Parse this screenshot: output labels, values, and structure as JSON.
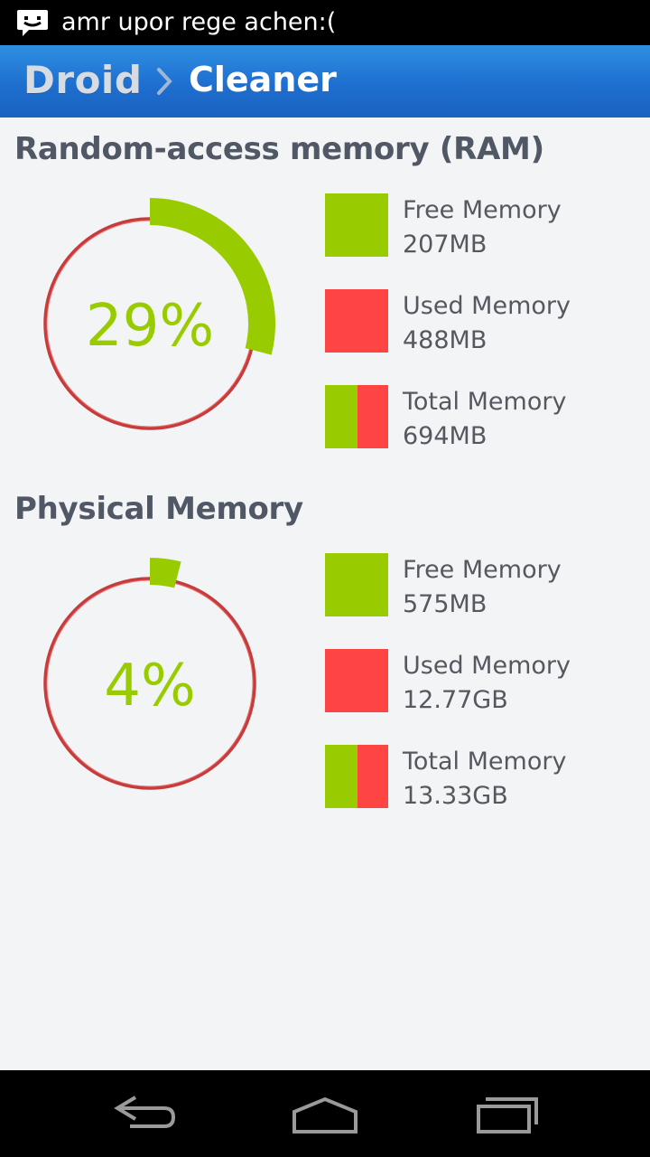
{
  "status_bar": {
    "notification_icon": "chat-bubble-icon",
    "notification_text": "amr upor rege achen:("
  },
  "action_bar": {
    "breadcrumb_root": "Droid",
    "separator_icon": "chevron-right-icon",
    "breadcrumb_current": "Cleaner"
  },
  "colors": {
    "accent_green": "#99cc00",
    "used_red": "#ff4444",
    "ring_red": "#d04545",
    "text_gray": "#55595f"
  },
  "sections": [
    {
      "title": "Random-access memory (RAM)",
      "percent_label": "29%",
      "percent_fraction": 0.29,
      "legend": [
        {
          "label": "Free Memory",
          "value": "207MB",
          "swatch": "free"
        },
        {
          "label": "Used Memory",
          "value": "488MB",
          "swatch": "used"
        },
        {
          "label": "Total Memory",
          "value": "694MB",
          "swatch": "total"
        }
      ]
    },
    {
      "title": "Physical Memory",
      "percent_label": "4%",
      "percent_fraction": 0.04,
      "legend": [
        {
          "label": "Free Memory",
          "value": "575MB",
          "swatch": "free"
        },
        {
          "label": "Used Memory",
          "value": "12.77GB",
          "swatch": "used"
        },
        {
          "label": "Total Memory",
          "value": "13.33GB",
          "swatch": "total"
        }
      ]
    }
  ],
  "nav_bar": {
    "back_icon": "back-icon",
    "home_icon": "home-icon",
    "recents_icon": "recents-icon"
  }
}
